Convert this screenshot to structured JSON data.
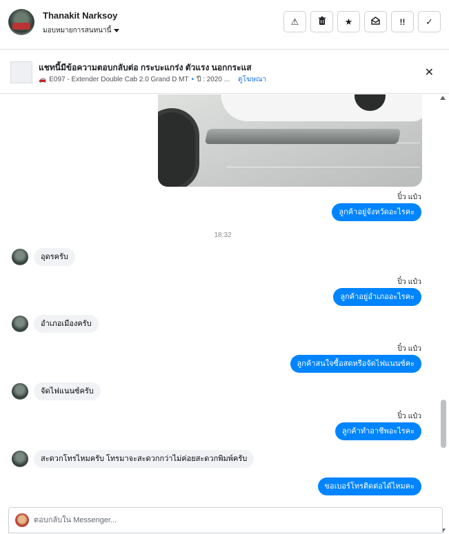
{
  "header": {
    "user_name": "Thanakit Narksoy",
    "assign_label": "มอบหมายการสนทนานี้",
    "actions": [
      {
        "icon": "warning-icon",
        "glyph": "⚠"
      },
      {
        "icon": "trash-icon",
        "glyph": "🗑"
      },
      {
        "icon": "star-icon",
        "glyph": "★"
      },
      {
        "icon": "mark-unread-icon",
        "glyph": "✉"
      },
      {
        "icon": "follow-up-icon",
        "glyph": "!!"
      },
      {
        "icon": "done-check-icon",
        "glyph": "✓"
      }
    ]
  },
  "listing": {
    "title": "แชทนี้มีข้อความตอบกลับต่อ กระบะแกร่ง ตัวแรง นอกกระแส",
    "meta_code": "E097 - Extender Double Cab 2.0 Grand D MT",
    "meta_separator": "•",
    "meta_year": "ปี : 2020 ...",
    "view_ad_link": "ดูโฆษณา",
    "close_icon": "✕"
  },
  "conversation": {
    "time_separator": "18:32",
    "messages": [
      {
        "id": "m1",
        "direction": "out",
        "sender": "ปิ๋ว แป๋ว",
        "text": "ลูกค้าอยู่จังหวัดอะไรคะ"
      },
      {
        "id": "m2",
        "direction": "in",
        "text": "อุดรครับ"
      },
      {
        "id": "m3",
        "direction": "out",
        "sender": "ปิ๋ว แป๋ว",
        "text": "ลูกค้าอยู่อำเภออะไรคะ"
      },
      {
        "id": "m4",
        "direction": "in",
        "text": "อำเภอเมืองครับ"
      },
      {
        "id": "m5",
        "direction": "out",
        "sender": "ปิ๋ว แป๋ว",
        "text": "ลูกค้าสนใจซื้อสดหรือจัดไฟแนนซ์คะ"
      },
      {
        "id": "m6",
        "direction": "in",
        "text": "จัดไฟแนนซ์ครับ"
      },
      {
        "id": "m7",
        "direction": "out",
        "sender": "ปิ๋ว แป๋ว",
        "text": "ลูกค้าทำอาชีพอะไรคะ"
      },
      {
        "id": "m8",
        "direction": "in",
        "text": "สะดวกโทรไหมครับ โทรมาจะสะดวกกว่าไม่ค่อยสะดวกพิมพ์ครับ"
      },
      {
        "id": "m9",
        "direction": "out",
        "text": "ขอเบอร์โทรติดต่อได้ไหมคะ"
      }
    ]
  },
  "composer": {
    "placeholder": "ตอบกลับใน Messenger..."
  },
  "colors": {
    "outgoing_bubble": "#0084ff",
    "incoming_bubble": "#f0f2f5",
    "link": "#1877f2"
  }
}
